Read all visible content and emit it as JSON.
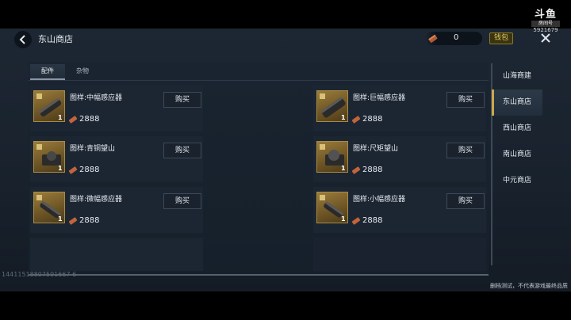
{
  "header": {
    "title": "东山商店",
    "currency_value": "0",
    "wallet_label": "钱包"
  },
  "watermark": {
    "logo": "斗鱼",
    "sub": "房间号",
    "room": "5921679"
  },
  "tabs": [
    {
      "label": "配件",
      "active": true
    },
    {
      "label": "杂物",
      "active": false
    }
  ],
  "items": [
    {
      "name": "图样:中幅感应器",
      "count": "1",
      "price": "2888",
      "buy_label": "购买",
      "icon": "scope-icon"
    },
    {
      "name": "图样:巨幅感应器",
      "count": "1",
      "price": "2888",
      "buy_label": "购买",
      "icon": "scope-icon"
    },
    {
      "name": "图样:青铜望山",
      "count": "1",
      "price": "2888",
      "buy_label": "购买",
      "icon": "sight-icon"
    },
    {
      "name": "图样:尺矩望山",
      "count": "1",
      "price": "2888",
      "buy_label": "购买",
      "icon": "sight-icon"
    },
    {
      "name": "图样:微幅感应器",
      "count": "1",
      "price": "2888",
      "buy_label": "购买",
      "icon": "scope-icon"
    },
    {
      "name": "图样:小幅感应器",
      "count": "1",
      "price": "2888",
      "buy_label": "购买",
      "icon": "scope-icon"
    }
  ],
  "shops": [
    {
      "label": "山海商建",
      "active": false
    },
    {
      "label": "东山商店",
      "active": true
    },
    {
      "label": "西山商店",
      "active": false
    },
    {
      "label": "南山商店",
      "active": false
    },
    {
      "label": "中元商店",
      "active": false
    }
  ],
  "uid": "14411518807591667 6",
  "disclaimer": "删档测试，不代表游戏最终品质",
  "colors": {
    "accent_gold": "#c9a94d",
    "thumb_gold": "#9a7c3b",
    "price_copper": "#c2643a"
  }
}
